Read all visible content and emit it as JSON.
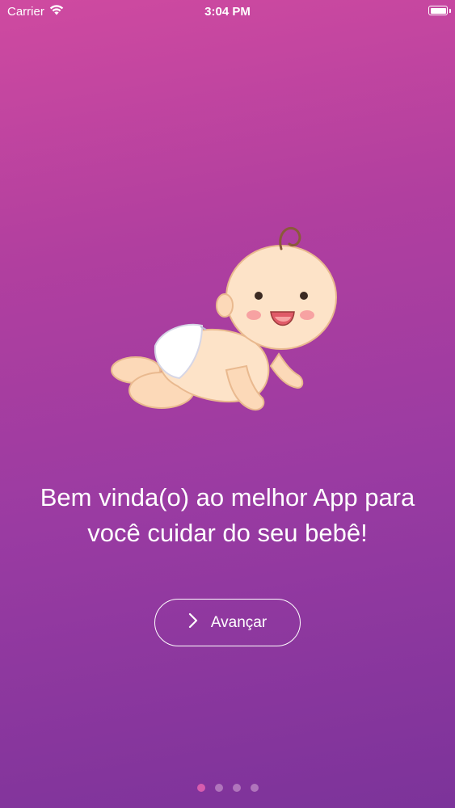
{
  "status_bar": {
    "carrier": "Carrier",
    "time": "3:04 PM"
  },
  "illustration": {
    "icon": "crawling-baby-illustration"
  },
  "onboarding": {
    "headline": "Bem vinda(o) ao melhor App para você cuidar do seu bebê!",
    "next_button_label": "Avançar"
  },
  "pagination": {
    "pages": 4,
    "current": 1
  },
  "colors": {
    "gradient_top": "#cf4aa0",
    "gradient_bottom": "#7c339a",
    "text": "#ffffff",
    "dot_active": "#e060b0",
    "dot_inactive": "#b57cc0"
  }
}
